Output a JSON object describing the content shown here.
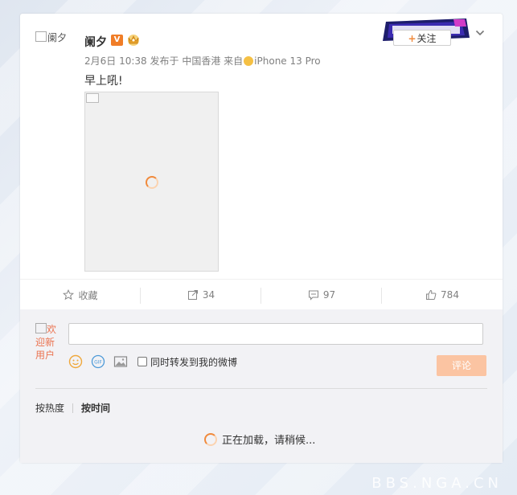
{
  "post": {
    "avatar_alt": "阑夕",
    "username": "阑夕",
    "verified_badge": "V",
    "date": "2月6日 10:38",
    "published_from": "发布于 中国香港",
    "source_prefix": "来自",
    "source_device": "iPhone 13 Pro",
    "text": "早上吼!"
  },
  "header": {
    "follow_plus": "+",
    "follow_label": "关注"
  },
  "actions": {
    "favorite": "收藏",
    "repost_count": "34",
    "comment_count": "97",
    "like_count": "784"
  },
  "comment": {
    "avatar_alt": "欢迎新用户",
    "input_value": "",
    "repost_option": "同时转发到我的微博",
    "submit": "评论",
    "sort_hot": "按热度",
    "sort_time": "按时间",
    "loading_text": "正在加载，请稍候..."
  },
  "watermark": "BBS.NGA.CN",
  "colors": {
    "accent": "#f08a3c",
    "vip_orange": "#f07d27",
    "submit_disabled": "#fbc4a2",
    "muted_text": "#808080"
  },
  "icons": [
    "star-icon",
    "repost-icon",
    "comment-icon",
    "like-icon",
    "emoji-icon",
    "gif-icon",
    "image-icon",
    "chevron-down-icon",
    "crown-icon",
    "loading-spinner-icon"
  ]
}
